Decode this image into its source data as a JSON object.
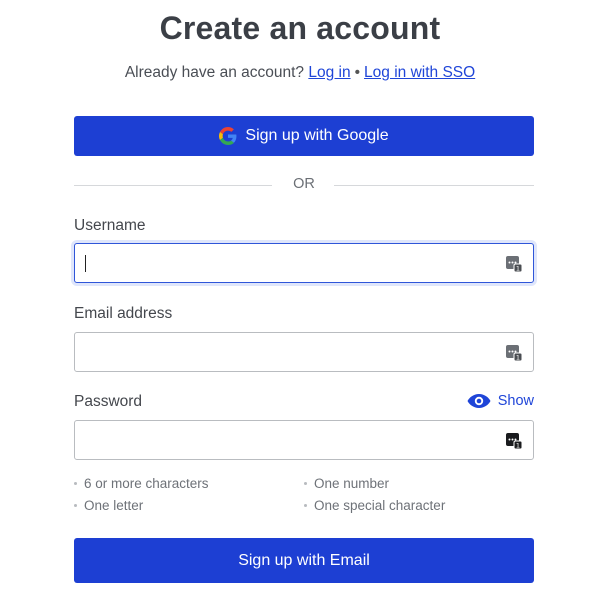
{
  "header": {
    "title": "Create an account",
    "subtitle_prefix": "Already have an account?",
    "login_link": "Log in",
    "separator": "•",
    "sso_link": "Log in with SSO"
  },
  "google_button": {
    "label": "Sign up with Google",
    "icon": "google-g-icon"
  },
  "divider": {
    "label": "OR"
  },
  "form": {
    "username": {
      "label": "Username",
      "value": "",
      "focused": true
    },
    "email": {
      "label": "Email address",
      "value": ""
    },
    "password": {
      "label": "Password",
      "value": "",
      "show_label": "Show"
    },
    "password_manager_icon": "password-manager-icon"
  },
  "requirements": [
    "6 or more characters",
    "One number",
    "One letter",
    "One special character"
  ],
  "submit": {
    "label": "Sign up with Email"
  },
  "colors": {
    "primary": "#1d3fd3",
    "link": "#1f45d8",
    "focus_border": "#2f56d9",
    "text": "#3b3f46"
  }
}
